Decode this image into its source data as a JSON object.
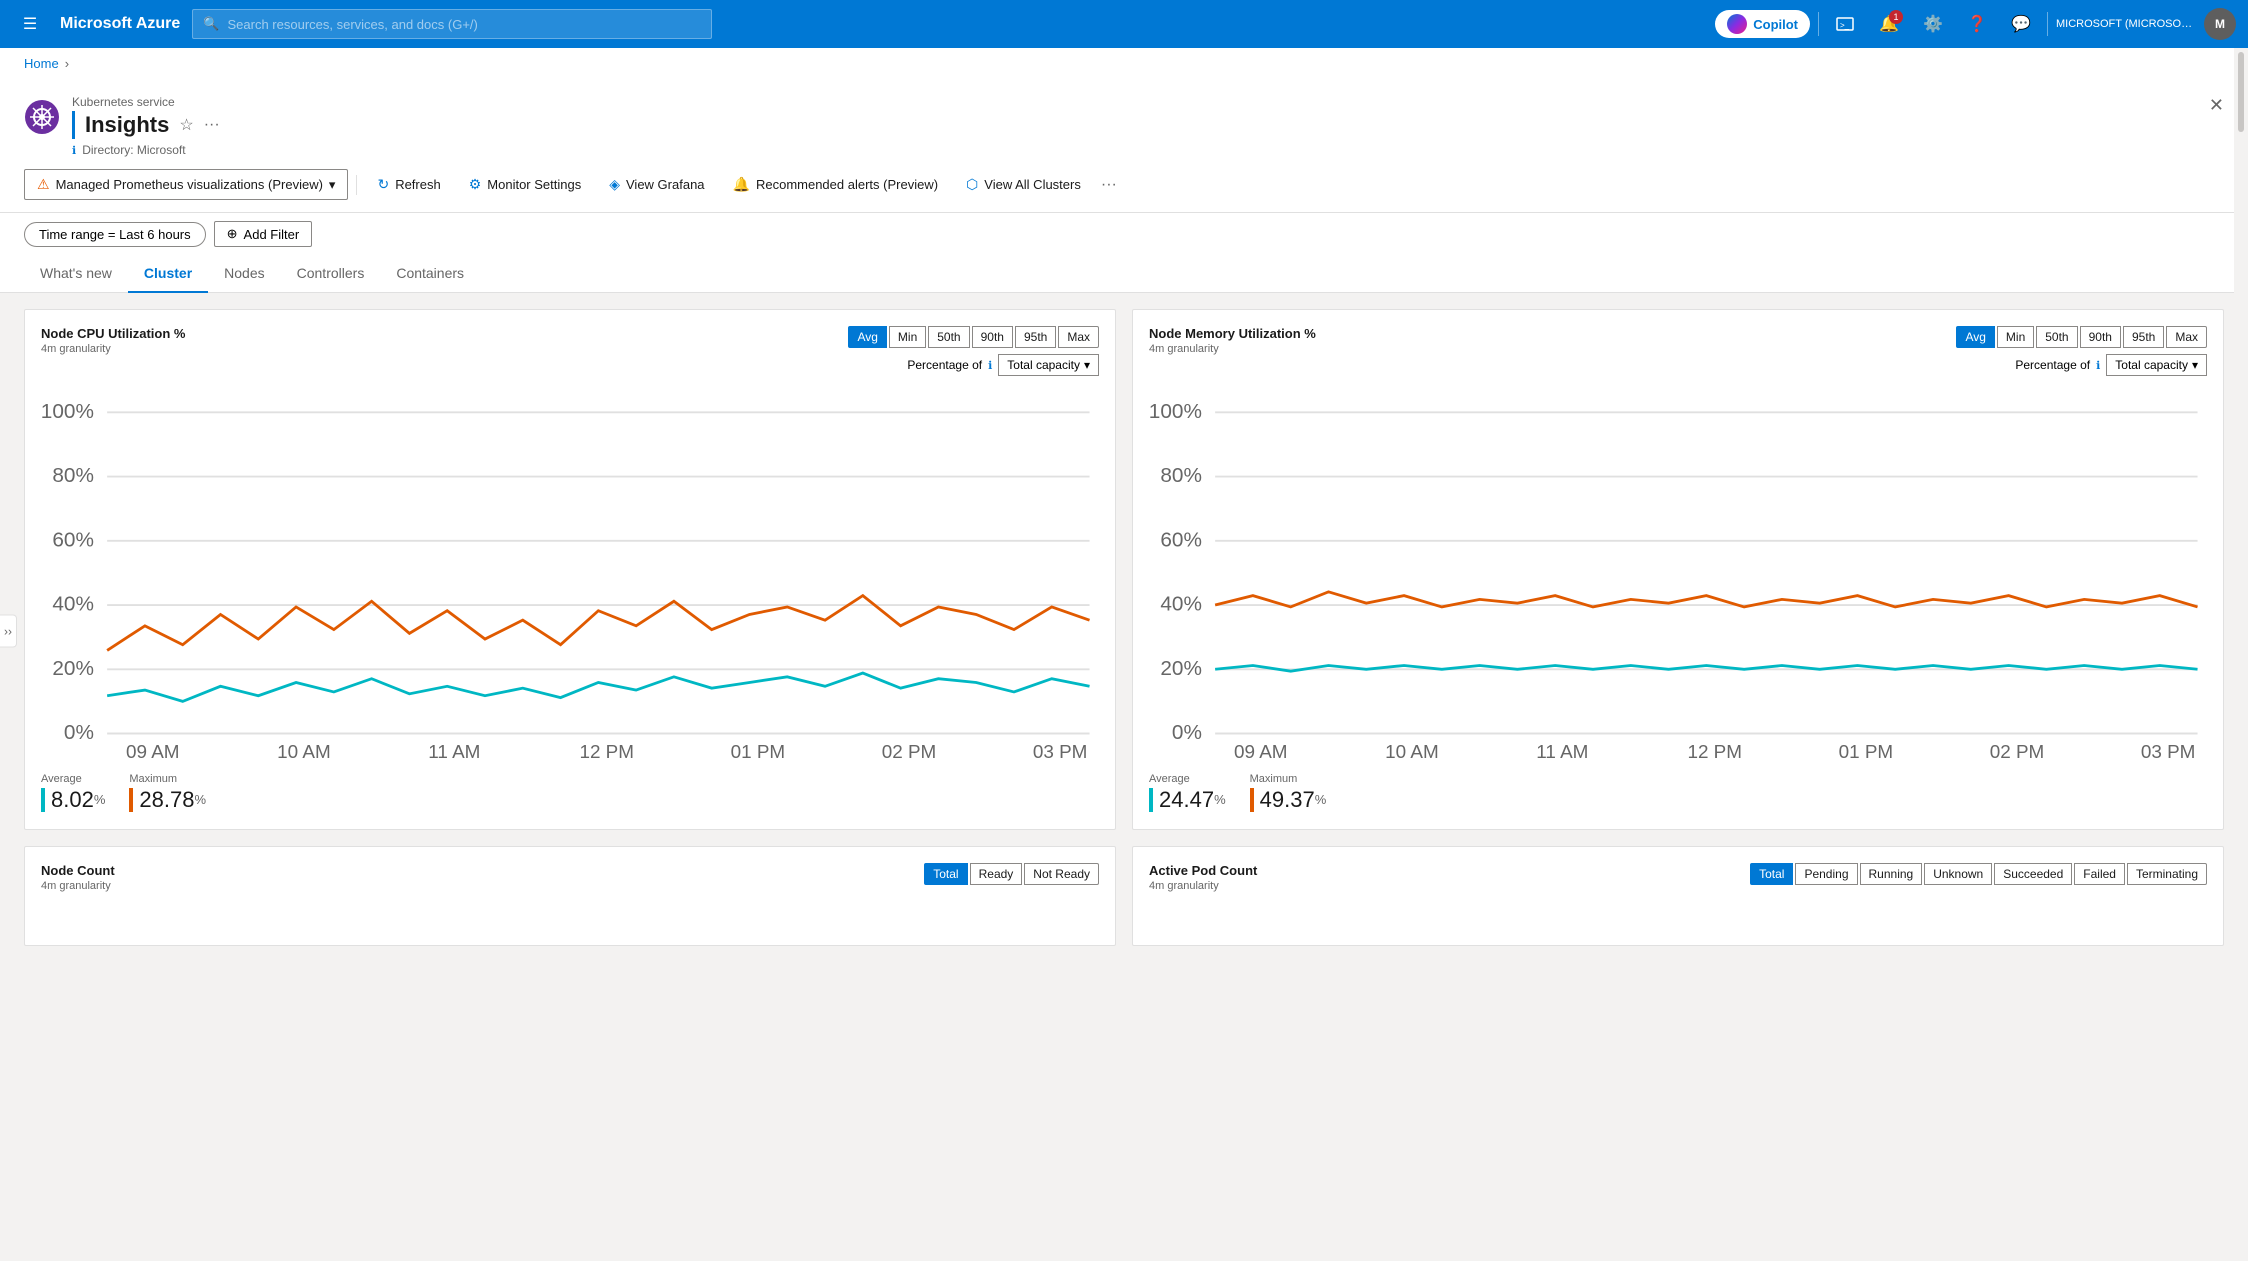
{
  "topNav": {
    "hamburger": "☰",
    "brand": "Microsoft Azure",
    "searchPlaceholder": "Search resources, services, and docs (G+/)",
    "copilot": "Copilot",
    "notifications": "1",
    "userDisplay": "MICROSOFT (MICROSOFT.ONMI...",
    "userInitials": "M"
  },
  "breadcrumb": {
    "home": "Home",
    "sep": "›"
  },
  "pageHeader": {
    "serviceLabel": "Kubernetes service",
    "title": "Insights",
    "directory": "Directory: Microsoft"
  },
  "toolbar": {
    "prometheusLabel": "Managed Prometheus visualizations (Preview)",
    "refreshLabel": "Refresh",
    "monitorSettingsLabel": "Monitor Settings",
    "viewGrafanaLabel": "View Grafana",
    "recommendedAlertsLabel": "Recommended alerts (Preview)",
    "viewAllClustersLabel": "View All Clusters"
  },
  "filters": {
    "timeRangeLabel": "Time range = Last 6 hours",
    "addFilterLabel": "Add Filter"
  },
  "tabs": [
    {
      "id": "whats-new",
      "label": "What's new"
    },
    {
      "id": "cluster",
      "label": "Cluster",
      "active": true
    },
    {
      "id": "nodes",
      "label": "Nodes"
    },
    {
      "id": "controllers",
      "label": "Controllers"
    },
    {
      "id": "containers",
      "label": "Containers"
    }
  ],
  "cpuChart": {
    "title": "Node CPU Utilization %",
    "granularity": "4m granularity",
    "statButtons": [
      "Avg",
      "Min",
      "50th",
      "90th",
      "95th",
      "Max"
    ],
    "activeStatIdx": 0,
    "percentageOfLabel": "Percentage of",
    "capacityOption": "Total capacity",
    "yLabels": [
      "100%",
      "80%",
      "60%",
      "40%",
      "20%",
      "0%"
    ],
    "xLabels": [
      "09 AM",
      "10 AM",
      "11 AM",
      "12 PM",
      "01 PM",
      "02 PM",
      "03 PM"
    ],
    "legendAvg": "Average",
    "legendMax": "Maximum",
    "avgValue": "8.02",
    "maxValue": "28.78",
    "unit": "%",
    "avgColor": "#00b7c3",
    "maxColor": "#e05a00"
  },
  "memoryChart": {
    "title": "Node Memory Utilization %",
    "granularity": "4m granularity",
    "statButtons": [
      "Avg",
      "Min",
      "50th",
      "90th",
      "95th",
      "Max"
    ],
    "activeStatIdx": 0,
    "percentageOfLabel": "Percentage of",
    "capacityOption": "Total capacity",
    "yLabels": [
      "100%",
      "80%",
      "60%",
      "40%",
      "20%",
      "0%"
    ],
    "xLabels": [
      "09 AM",
      "10 AM",
      "11 AM",
      "12 PM",
      "01 PM",
      "02 PM",
      "03 PM"
    ],
    "legendAvg": "Average",
    "legendMax": "Maximum",
    "avgValue": "24.47",
    "maxValue": "49.37",
    "unit": "%",
    "avgColor": "#00b7c3",
    "maxColor": "#e05a00"
  },
  "nodeCountChart": {
    "title": "Node Count",
    "granularity": "4m granularity",
    "statButtons": [
      "Total",
      "Ready",
      "Not Ready"
    ],
    "activeStatIdx": 0
  },
  "activePodChart": {
    "title": "Active Pod Count",
    "granularity": "4m granularity",
    "statButtons": [
      "Total",
      "Pending",
      "Running",
      "Unknown",
      "Succeeded",
      "Failed",
      "Terminating"
    ]
  }
}
